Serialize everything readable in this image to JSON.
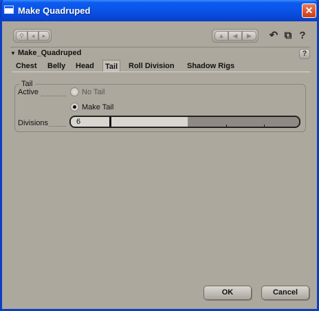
{
  "window": {
    "title": "Make Quadruped",
    "close_glyph": "✕"
  },
  "toolbar": {
    "left_icons": [
      "key-icon",
      "arrow-left-icon",
      "arrow-right-icon"
    ],
    "right_icons": [
      "arrow-up-icon",
      "arrow-left-icon",
      "arrow-right-icon"
    ],
    "undo_glyph": "↶",
    "copy_glyph": "⧉",
    "help_glyph": "?"
  },
  "panel": {
    "title": "Make_Quadruped",
    "expand_glyph": "▼",
    "help_glyph": "?"
  },
  "tabs": [
    {
      "label": "Chest",
      "active": false
    },
    {
      "label": "Belly",
      "active": false
    },
    {
      "label": "Head",
      "active": false
    },
    {
      "label": "Tail",
      "active": true
    },
    {
      "label": "Roll Division",
      "active": false
    },
    {
      "label": "Shadow Rigs",
      "active": false
    }
  ],
  "group": {
    "title": "Tail",
    "active_label": "Active",
    "options": [
      {
        "label": "No Tail",
        "checked": false
      },
      {
        "label": "Make Tail",
        "checked": true
      }
    ],
    "divisions_label": "Divisions",
    "divisions_value": "6"
  },
  "buttons": {
    "ok": "OK",
    "cancel": "Cancel"
  },
  "colors": {
    "title_bar": "#0a53e6",
    "background": "#aca89e",
    "close": "#cc3a12"
  }
}
